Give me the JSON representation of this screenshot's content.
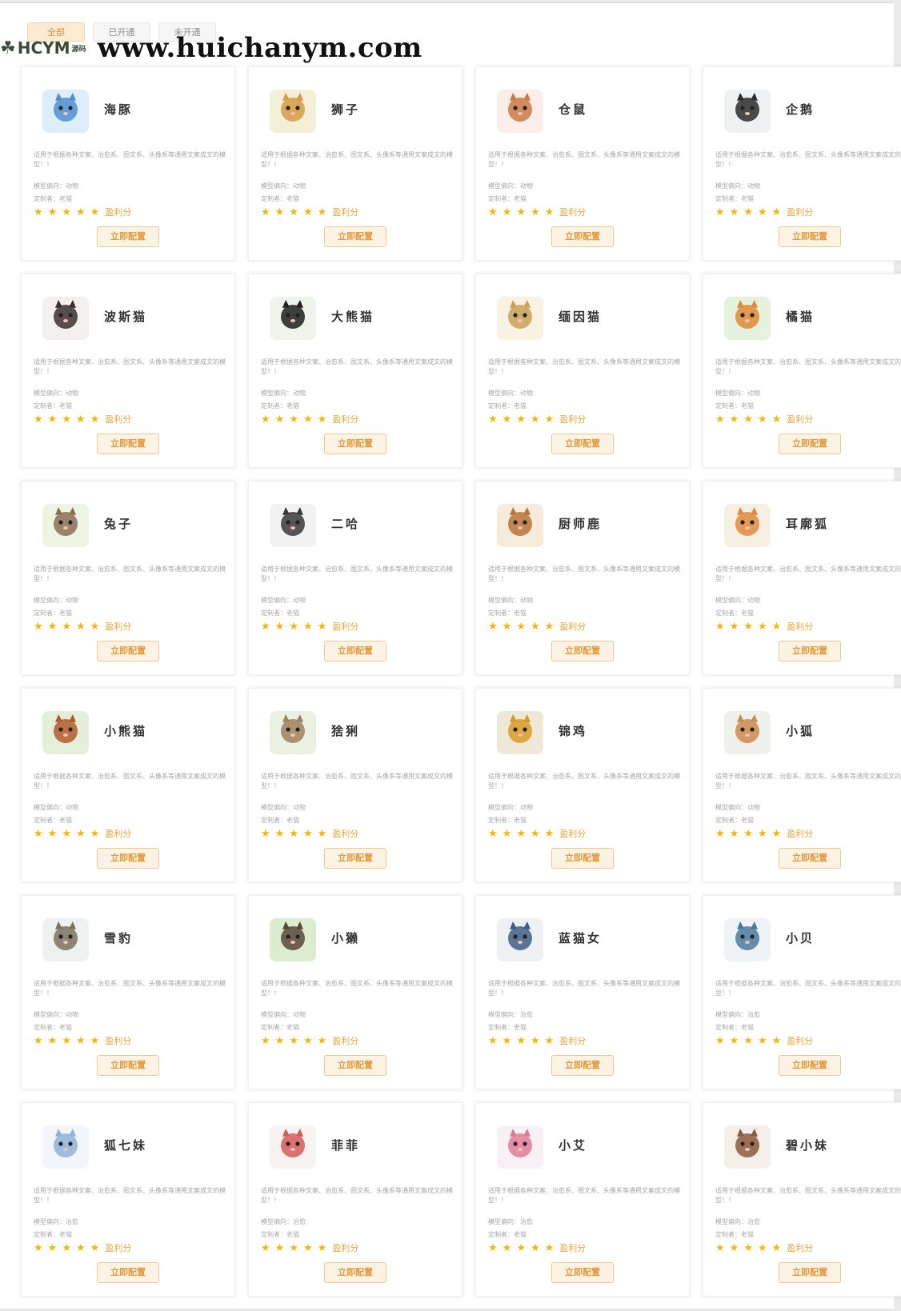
{
  "tabs": [
    {
      "label": "全部",
      "active": true
    },
    {
      "label": "已开通",
      "active": false
    },
    {
      "label": "未开通",
      "active": false
    }
  ],
  "watermark": {
    "logo_text": "HCYM",
    "logo_sub": "源码",
    "url": "www.huichanym.com"
  },
  "card_common": {
    "desc": "适用于根据各种文案、治愈系、图文系、头像系等通用文案成文的模型！！",
    "creator": "定制者：老猫",
    "score_label": "盈利分",
    "button_label": "立即配置",
    "star_color": "#f5b50a",
    "accent_color": "#e29a3b"
  },
  "cards": [
    {
      "name": "海豚",
      "tendency": "模型偏向：动物",
      "icon": "dolphin-icon",
      "bg": "#dbeefa",
      "fg": "#4d8fd1"
    },
    {
      "name": "狮子",
      "tendency": "模型偏向：动物",
      "icon": "lion-icon",
      "bg": "#f3efd8",
      "fg": "#d69a45"
    },
    {
      "name": "仓鼠",
      "tendency": "模型偏向：动物",
      "icon": "hamster-icon",
      "bg": "#fbeeea",
      "fg": "#c97a44"
    },
    {
      "name": "企鹅",
      "tendency": "模型偏向：动物",
      "icon": "penguin-icon",
      "bg": "#eef1f1",
      "fg": "#2d2d2d"
    },
    {
      "name": "波斯猫",
      "tendency": "模型偏向：动物",
      "icon": "persian-cat-icon",
      "bg": "#f3f0ee",
      "fg": "#3a3030"
    },
    {
      "name": "大熊猫",
      "tendency": "模型偏向：动物",
      "icon": "panda-icon",
      "bg": "#eff4ea",
      "fg": "#1f1f1f"
    },
    {
      "name": "缅因猫",
      "tendency": "模型偏向：动物",
      "icon": "maine-coon-icon",
      "bg": "#f9f1e1",
      "fg": "#caa05a"
    },
    {
      "name": "橘猫",
      "tendency": "模型偏向：动物",
      "icon": "orange-cat-icon",
      "bg": "#e6f1de",
      "fg": "#e08a34"
    },
    {
      "name": "兔子",
      "tendency": "模型偏向：动物",
      "icon": "rabbit-icon",
      "bg": "#eef4e3",
      "fg": "#8c6d52"
    },
    {
      "name": "二哈",
      "tendency": "模型偏向：动物",
      "icon": "husky-icon",
      "bg": "#f2f2f2",
      "fg": "#3a3a3a"
    },
    {
      "name": "厨师鹿",
      "tendency": "模型偏向：动物",
      "icon": "chef-deer-icon",
      "bg": "#f7ecdc",
      "fg": "#b9743b"
    },
    {
      "name": "耳廓狐",
      "tendency": "模型偏向：动物",
      "icon": "fennec-fox-icon",
      "bg": "#f6efe3",
      "fg": "#e08b3d"
    },
    {
      "name": "小熊猫",
      "tendency": "模型偏向：动物",
      "icon": "red-panda-icon",
      "bg": "#e3efd9",
      "fg": "#b35b2a"
    },
    {
      "name": "猞猁",
      "tendency": "模型偏向：动物",
      "icon": "lynx-icon",
      "bg": "#eaf1e0",
      "fg": "#a0805e"
    },
    {
      "name": "锦鸡",
      "tendency": "模型偏向：动物",
      "icon": "golden-pheasant-icon",
      "bg": "#efe8d6",
      "fg": "#d99a26"
    },
    {
      "name": "小狐",
      "tendency": "模型偏向：动物",
      "icon": "little-fox-icon",
      "bg": "#eef0ea",
      "fg": "#cf8a4a"
    },
    {
      "name": "雪豹",
      "tendency": "模型偏向：动物",
      "icon": "snow-leopard-icon",
      "bg": "#eef2ef",
      "fg": "#7c7160"
    },
    {
      "name": "小獭",
      "tendency": "模型偏向：动物",
      "icon": "otter-icon",
      "bg": "#dcedcf",
      "fg": "#5b463a"
    },
    {
      "name": "蓝猫女",
      "tendency": "模型偏向：治愈",
      "icon": "blue-cat-girl-icon",
      "bg": "#eef1f4",
      "fg": "#3d5f86"
    },
    {
      "name": "小贝",
      "tendency": "模型偏向：治愈",
      "icon": "xiaobei-girl-icon",
      "bg": "#eef3f6",
      "fg": "#4a7aa0"
    },
    {
      "name": "狐七妹",
      "tendency": "模型偏向：治愈",
      "icon": "fox-sister-icon",
      "bg": "#f2f6fa",
      "fg": "#8fb3d8"
    },
    {
      "name": "菲菲",
      "tendency": "模型偏向：治愈",
      "icon": "feifei-girl-icon",
      "bg": "#f6f3f0",
      "fg": "#d45a5a"
    },
    {
      "name": "小艾",
      "tendency": "模型偏向：治愈",
      "icon": "xiaoai-girl-icon",
      "bg": "#f7f0f4",
      "fg": "#e07b96"
    },
    {
      "name": "碧小妹",
      "tendency": "模型偏向：治愈",
      "icon": "bi-sister-icon",
      "bg": "#f5efe9",
      "fg": "#8a5a3c"
    }
  ]
}
